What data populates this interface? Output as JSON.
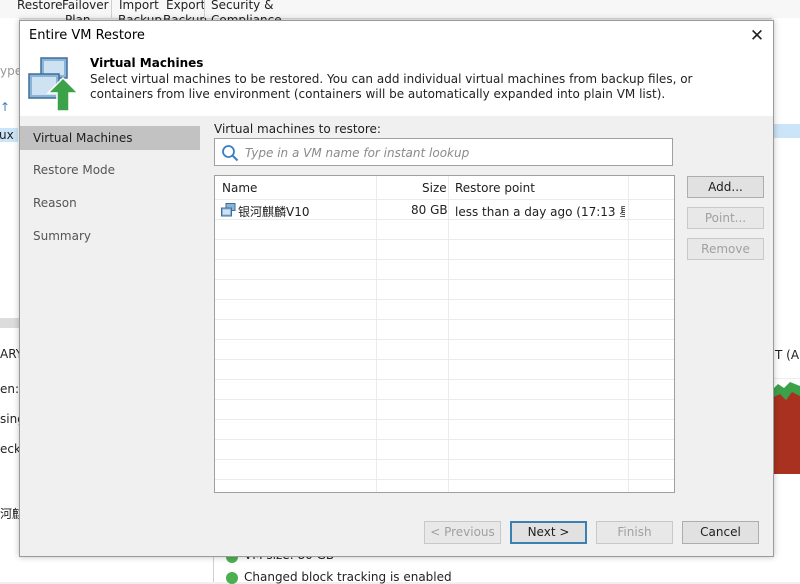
{
  "background": {
    "ribbon": [
      {
        "line1": "Restore",
        "line2": ""
      },
      {
        "line1": "Failover",
        "line2": "Plan"
      },
      {
        "line1": "Import",
        "line2": "Backup"
      },
      {
        "line1": "Export",
        "line2": "Backup"
      },
      {
        "line1": "Security &",
        "line2": "Compliance"
      }
    ],
    "left_texts": [
      "ype",
      "ux",
      "ARY",
      "en:",
      "sing",
      "eck",
      "河麒"
    ],
    "right_text": "T (ALL",
    "status_lines": [
      "VM size: 80 GB",
      "Changed block tracking is enabled"
    ]
  },
  "dialog": {
    "title": "Entire VM Restore",
    "close_symbol": "✕",
    "header_title": "Virtual Machines",
    "header_description": "Select virtual machines to be restored. You can add individual virtual machines from backup files, or containers from live environment (containers will be automatically expanded into plain VM list).",
    "steps": [
      "Virtual Machines",
      "Restore Mode",
      "Reason",
      "Summary"
    ],
    "active_step": "Virtual Machines",
    "vms_label": "Virtual machines to restore:",
    "search_placeholder": "Type in a VM name for instant lookup",
    "table": {
      "columns": [
        "Name",
        "Size",
        "Restore point"
      ],
      "rows": [
        {
          "name": "银河麒麟V10",
          "size": "80 GB",
          "restore_point": "less than a day ago (17:13 星..."
        }
      ]
    },
    "side_buttons": {
      "add": "Add...",
      "point": "Point...",
      "remove": "Remove"
    },
    "footer_buttons": {
      "previous": "< Previous",
      "next": "Next >",
      "finish": "Finish",
      "cancel": "Cancel"
    }
  },
  "colors": {
    "accent_green": "#3ca24a",
    "active_step_bg": "#c2c2c2",
    "primary_border": "#3c7fb1"
  }
}
